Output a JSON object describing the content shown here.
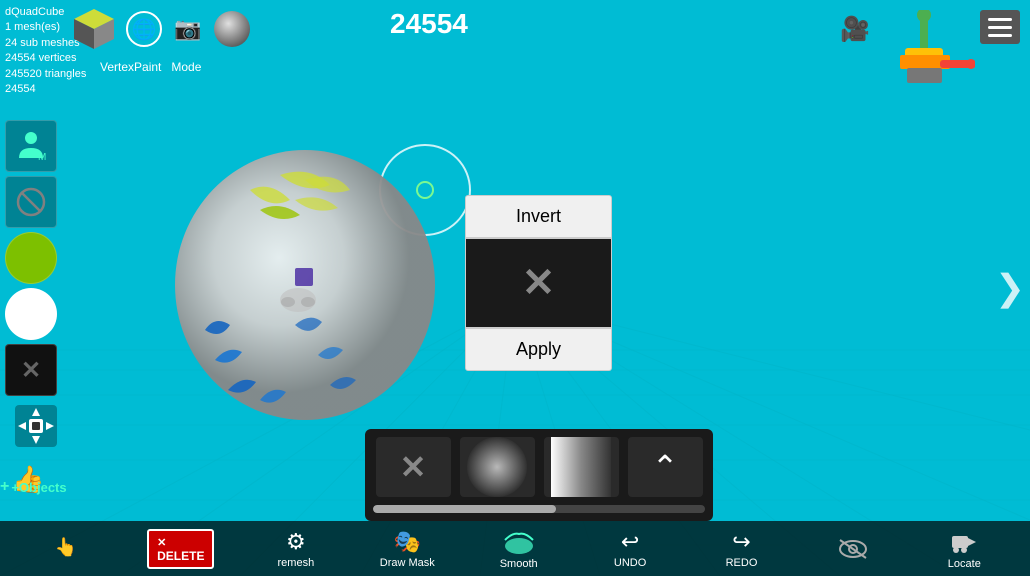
{
  "app": {
    "title": "dQuadCube",
    "mesh_count": "1 mesh(es)",
    "sub_meshes": "24 sub meshes",
    "vertices": "24554 vertices",
    "triangles": "245520 triangles",
    "id": "24554",
    "counter": "24554",
    "vertex_paint_label": "VertexPaint",
    "mode_label": "Mode"
  },
  "toolbar": {
    "invert_label": "Invert",
    "apply_label": "Apply"
  },
  "bottom_toolbar": {
    "remesh_label": "remesh",
    "draw_mask_label": "Draw Mask",
    "smooth_label": "Smooth",
    "undo_label": "UNDO",
    "redo_label": "REDO",
    "locate_label": "Locate",
    "delete_label": "DELETE",
    "objects_label": "+Objects"
  },
  "colors": {
    "background": "#00BCD4",
    "accent": "#4fc",
    "toolbar_bg": "rgba(0,0,0,0.7)"
  }
}
